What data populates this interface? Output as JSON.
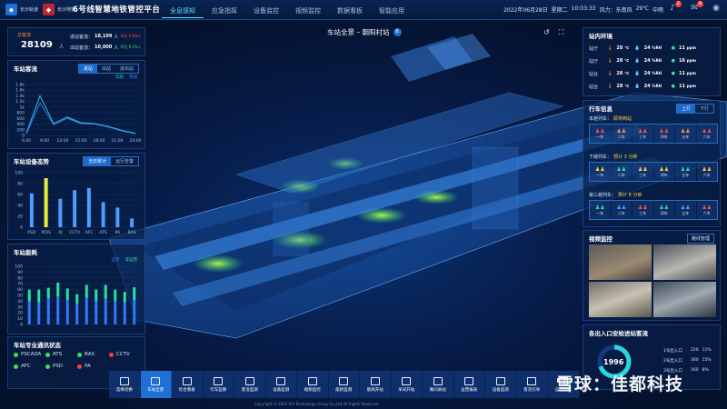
{
  "header": {
    "logo1": "长沙轨道",
    "logo2": "长沙地铁",
    "title": "6号线智慧地铁管控平台",
    "nav": [
      "全息感知",
      "应急指挥",
      "设备监控",
      "视频监控",
      "数据看板",
      "智能应用"
    ],
    "date": "2022年06月28日",
    "weekday": "星期二",
    "time": "10:03:33",
    "wind": "风力：东南风",
    "temp": "29℃",
    "aqi": "中雨",
    "alert_count": "2",
    "msg_count": "6"
  },
  "passenger": {
    "total_label": "总客流",
    "total_value": "28109",
    "total_unit": "人",
    "in_label": "进站客流：",
    "in_value": "18,109",
    "in_unit": "人",
    "in_pct": "环比 6.8%↑",
    "out_label": "出站客流：",
    "out_value": "10,000",
    "out_unit": "人",
    "out_pct": "环比 6.4%↓"
  },
  "flow_chart": {
    "title": "车站客流",
    "tabs": [
      "进站",
      "出站",
      "进出站"
    ],
    "legend": [
      "实际",
      "预测"
    ]
  },
  "device_chart": {
    "title": "车站设备态势",
    "tabs": [
      "当日累计",
      "运行告警"
    ]
  },
  "energy_chart": {
    "title": "车站能耗",
    "legend": [
      "运营",
      "非运营"
    ]
  },
  "comm_status": {
    "title": "车站专业通讯状态",
    "items": [
      {
        "label": "PSCADA",
        "color": "#3ddc5a"
      },
      {
        "label": "ATS",
        "color": "#3ddc5a"
      },
      {
        "label": "BAS",
        "color": "#3ddc5a"
      },
      {
        "label": "CCTV",
        "color": "#ff3b3b"
      },
      {
        "label": "AFC",
        "color": "#3ddc5a"
      },
      {
        "label": "PSD",
        "color": "#3ddc5a"
      },
      {
        "label": "PA",
        "color": "#ff3b3b"
      }
    ]
  },
  "chart_data": [
    {
      "type": "line",
      "title": "车站客流",
      "x": [
        "6:00",
        "9:00",
        "12:00",
        "15:00",
        "18:00",
        "21:00",
        "24:00"
      ],
      "ylim": [
        0,
        1800
      ],
      "yticks": [
        "0",
        "200",
        "400",
        "600",
        "800",
        "1k",
        "1.2k",
        "1.4k",
        "1.6k",
        "1.8k"
      ],
      "series": [
        {
          "name": "实际",
          "values": [
            80,
            1400,
            420,
            650,
            450,
            420,
            320,
            180,
            80
          ]
        },
        {
          "name": "预测",
          "values": [
            60,
            1150,
            380,
            600,
            420,
            400,
            300,
            160,
            60
          ]
        }
      ]
    },
    {
      "type": "bar",
      "title": "车站设备态势",
      "categories": [
        "PSD",
        "PIDS",
        "AJ",
        "CCTV",
        "AFC",
        "ATS",
        "PA",
        "BAS"
      ],
      "values": [
        62,
        90,
        52,
        68,
        72,
        46,
        36,
        16
      ],
      "ylim": [
        0,
        100
      ],
      "yticks": [
        "0",
        "20",
        "40",
        "60",
        "80",
        "100"
      ]
    },
    {
      "type": "bar",
      "title": "车站能耗",
      "categories": [
        "1月",
        "2月",
        "3月",
        "4月",
        "5月",
        "6月",
        "7月",
        "8月",
        "9月",
        "10月",
        "11月",
        "12月"
      ],
      "series": [
        {
          "name": "运营",
          "values": [
            40,
            38,
            45,
            48,
            42,
            36,
            46,
            40,
            44,
            40,
            38,
            42
          ]
        },
        {
          "name": "非运营",
          "values": [
            20,
            22,
            18,
            24,
            20,
            16,
            22,
            20,
            24,
            20,
            18,
            22
          ]
        }
      ],
      "ylim": [
        0,
        100
      ],
      "yticks": [
        "0",
        "10",
        "20",
        "30",
        "40",
        "50",
        "60",
        "70",
        "80",
        "90",
        "100"
      ]
    }
  ],
  "scene": {
    "title": "车站全景 – 朝阳村站",
    "badge": "6"
  },
  "env": {
    "title": "站内环境",
    "rows": [
      {
        "name": "站厅",
        "temp": "28",
        "hum": "24",
        "pm": "11"
      },
      {
        "name": "站厅",
        "temp": "28",
        "hum": "24",
        "pm": "16"
      },
      {
        "name": "站台",
        "temp": "28",
        "hum": "24",
        "pm": "11"
      },
      {
        "name": "站台",
        "temp": "28",
        "hum": "24",
        "pm": "11"
      }
    ],
    "temp_unit": "℃",
    "hum_unit": "%RH",
    "pm_unit": "ppm"
  },
  "train": {
    "title": "行车信息",
    "tabs": [
      "上行",
      "下行"
    ],
    "trains": [
      {
        "label": "本趟列车：",
        "status": "即将到站"
      },
      {
        "label": "下趟列车：",
        "status": "预计 3 分钟"
      },
      {
        "label": "第三趟列车：",
        "status": "预计 8 分钟"
      }
    ],
    "cars": [
      "一车",
      "二车",
      "三车",
      "四车",
      "五车",
      "六车"
    ]
  },
  "video": {
    "title": "视频监控",
    "manage": "路线管理"
  },
  "gate": {
    "title": "各出入口安检进站客流",
    "total": "1996",
    "rows": [
      {
        "name": "1号出入口",
        "count": "220",
        "pct": "11%"
      },
      {
        "name": "2号出入口",
        "count": "300",
        "pct": "15%"
      },
      {
        "name": "3号出入口",
        "count": "160",
        "pct": "8%"
      }
    ]
  },
  "toolbar": {
    "items": [
      "选择切换",
      "车站全景",
      "综合看板",
      "行车监察",
      "客流监测",
      "设备监测",
      "视频监控",
      "能耗监测",
      "能耗开站",
      "早间开站",
      "晚间关站",
      "运营报表",
      "设备监测",
      "客流引导",
      "应急指挥"
    ]
  },
  "footer": "Copyright © 2022 PCI Technology Group Co.,Ltd All Rights Reserved",
  "watermark": "雪球：佳都科技"
}
